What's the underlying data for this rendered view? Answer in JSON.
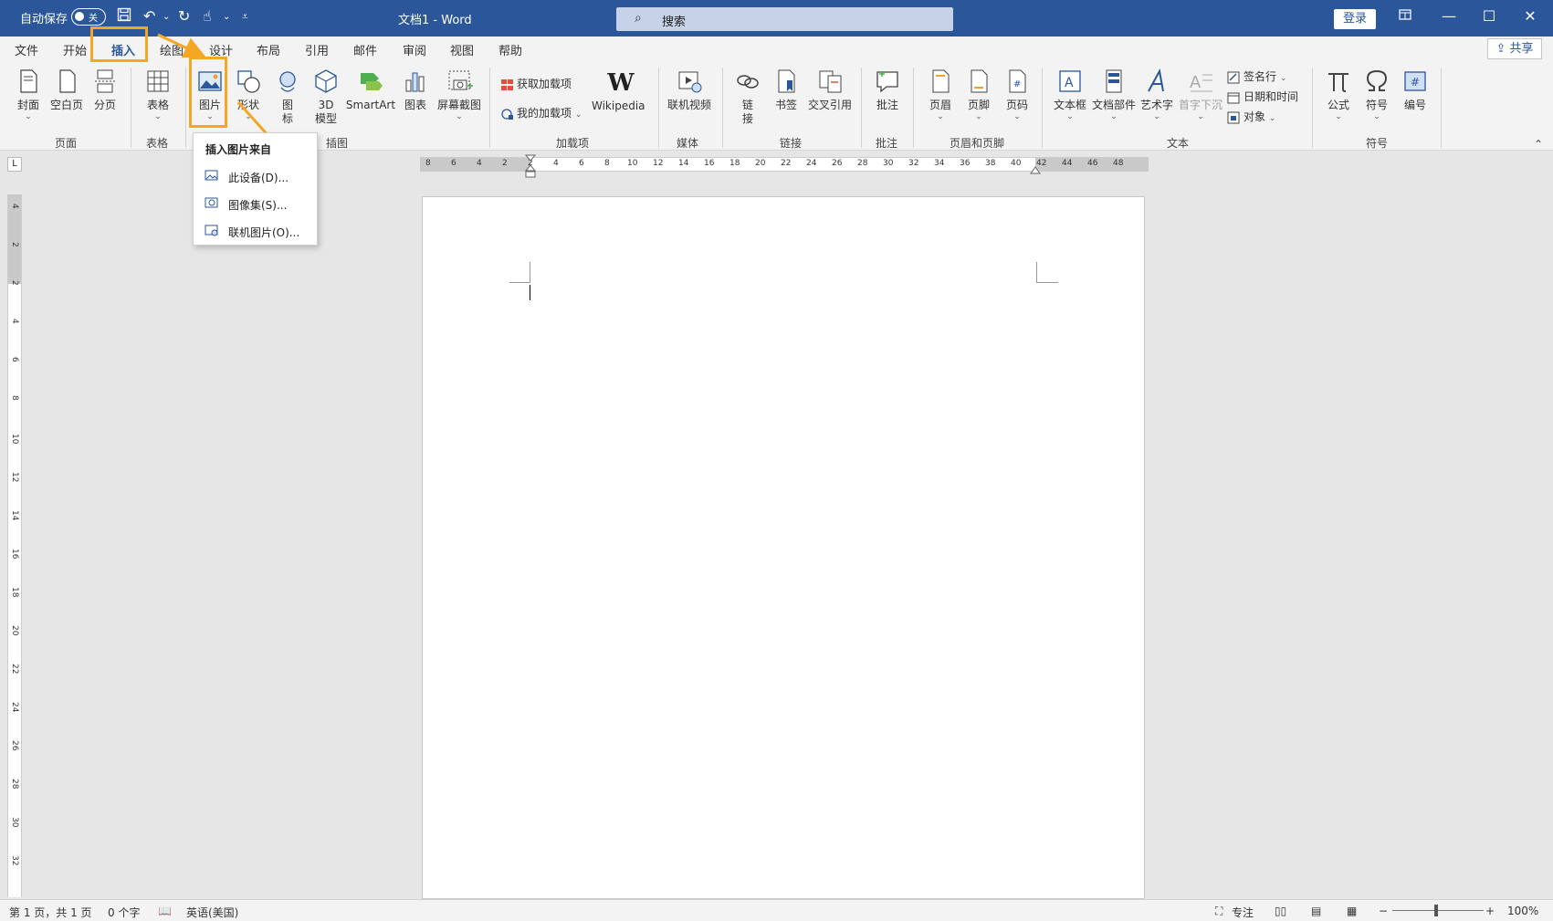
{
  "titlebar": {
    "autosave_label": "自动保存",
    "autosave_state": "关",
    "document_title": "文档1  -  Word",
    "search_placeholder": "搜索",
    "login_label": "登录",
    "accent_color": "#2b579a"
  },
  "menu": {
    "tabs": [
      "文件",
      "开始",
      "插入",
      "绘图",
      "设计",
      "布局",
      "引用",
      "邮件",
      "审阅",
      "视图",
      "帮助"
    ],
    "active_tab": "插入",
    "share_label": "共享"
  },
  "ribbon": {
    "pages": {
      "cover": "封面",
      "blank": "空白页",
      "break": "分页",
      "group": "页面"
    },
    "tables": {
      "table": "表格",
      "group": "表格"
    },
    "illustrations": {
      "picture": "图片",
      "shapes": "形状",
      "icons_line1": "图",
      "icons_line2": "标",
      "model_line1": "3D",
      "model_line2": "模型",
      "smartart": "SmartArt",
      "chart": "图表",
      "screenshot": "屏幕截图",
      "group": "插图"
    },
    "addins": {
      "get": "获取加载项",
      "mine": "我的加载项",
      "wikipedia": "Wikipedia",
      "group": "加载项"
    },
    "media": {
      "online_video": "联机视频",
      "group": "媒体"
    },
    "links": {
      "link_line1": "链",
      "link_line2": "接",
      "bookmark": "书签",
      "crossref": "交叉引用",
      "group": "链接"
    },
    "comments": {
      "comment": "批注",
      "group": "批注"
    },
    "header_footer": {
      "header": "页眉",
      "footer": "页脚",
      "page_number": "页码",
      "group": "页眉和页脚"
    },
    "text": {
      "textbox": "文本框",
      "parts": "文档部件",
      "wordart": "艺术字",
      "dropcap": "首字下沉",
      "signature": "签名行",
      "datetime": "日期和时间",
      "object": "对象",
      "group": "文本"
    },
    "symbols": {
      "equation": "公式",
      "symbol": "符号",
      "number": "编号",
      "group": "符号"
    },
    "highlight_color": "#f5a623"
  },
  "dropdown": {
    "title": "插入图片来自",
    "items": [
      "此设备(D)...",
      "图像集(S)...",
      "联机图片(O)..."
    ]
  },
  "ruler": {
    "h_ticks": [
      "8",
      "6",
      "4",
      "2",
      "2",
      "4",
      "6",
      "8",
      "10",
      "12",
      "14",
      "16",
      "18",
      "20",
      "22",
      "24",
      "26",
      "28",
      "30",
      "32",
      "34",
      "36",
      "38",
      "40",
      "42",
      "44",
      "46",
      "48"
    ],
    "v_ticks": [
      "4",
      "2",
      "2",
      "4",
      "6",
      "8",
      "10",
      "12",
      "14",
      "16",
      "18",
      "20",
      "22",
      "24",
      "26",
      "28",
      "30",
      "32"
    ],
    "corner": "L"
  },
  "status": {
    "page": "第 1 页，共 1 页",
    "words": "0 个字",
    "language": "英语(美国)",
    "focus": "专注",
    "zoom": "100%"
  }
}
